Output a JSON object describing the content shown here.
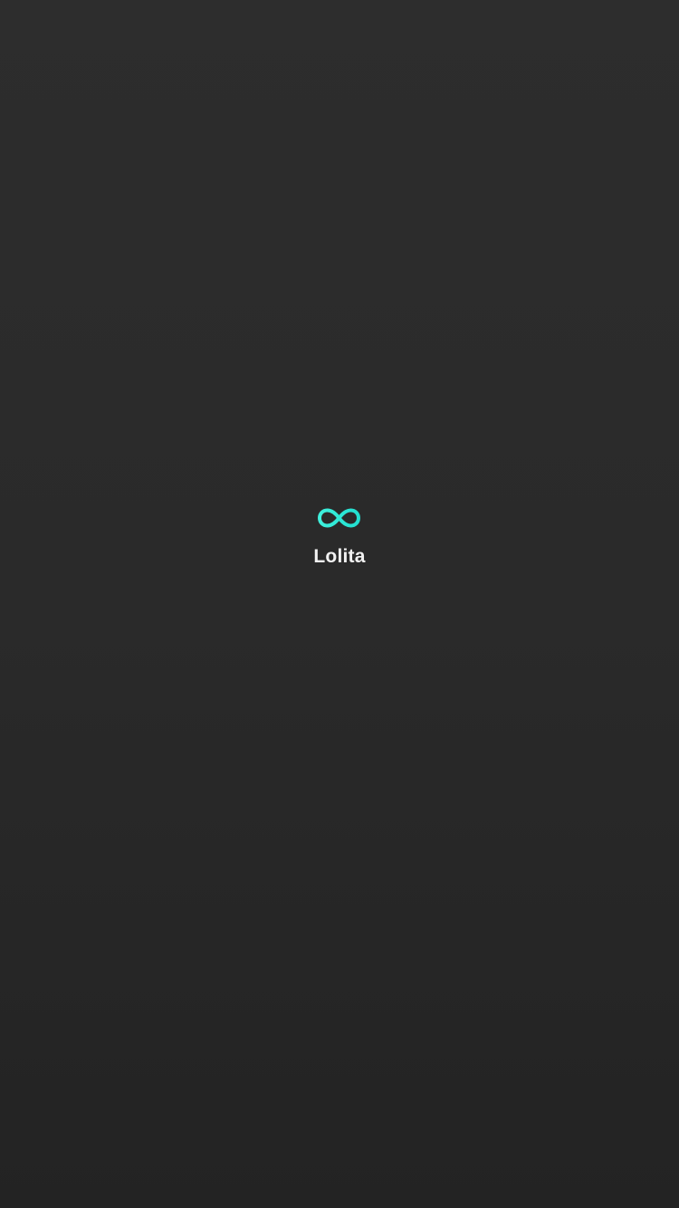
{
  "splash": {
    "app_name": "Lolita",
    "logo_icon": "infinity-icon",
    "accent_color": "#2ee8d6",
    "text_color": "#f2f2f2",
    "background_color": "#2a2a2a"
  }
}
